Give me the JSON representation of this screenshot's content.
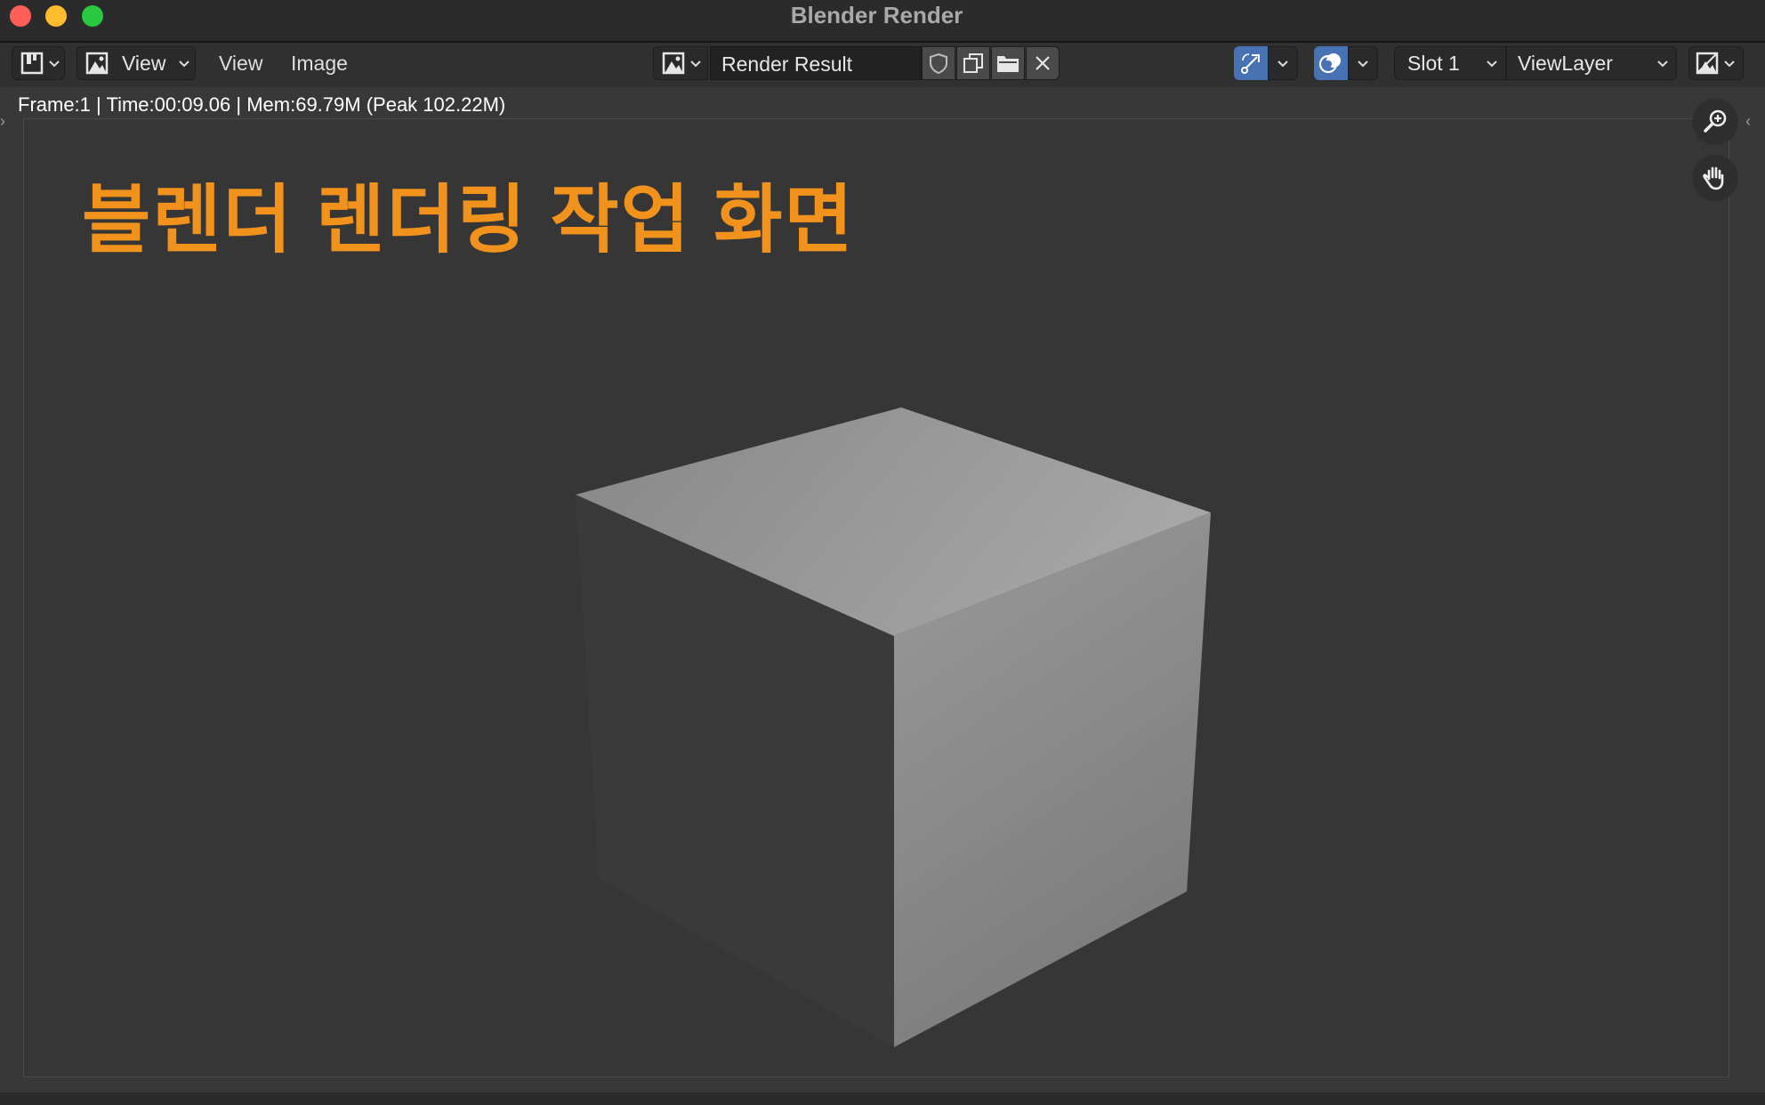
{
  "window": {
    "title": "Blender Render"
  },
  "header": {
    "view_dropdown_label": "View",
    "menus": [
      {
        "label": "View"
      },
      {
        "label": "Image"
      }
    ],
    "image_name": "Render Result",
    "slot_label": "Slot 1",
    "view_layer_label": "ViewLayer"
  },
  "status": {
    "text": "Frame:1 | Time:00:09.06 | Mem:69.79M (Peak 102.22M)"
  },
  "canvas": {
    "overlay_title": "블렌더 렌더링 작업 화면"
  },
  "icons": {
    "editor_type": "image-editor-icon",
    "view_mode": "image-view-icon",
    "browse_image": "browse-image-icon",
    "fake_user": "shield-icon",
    "new_image": "duplicate-icon",
    "open_image": "folder-icon",
    "unlink": "close-icon",
    "gizmo": "gizmo-icon",
    "overlay": "overlay-icon",
    "display_channels": "display-channels-icon",
    "zoom": "zoom-icon",
    "pan": "hand-icon"
  },
  "colors": {
    "accent_orange": "#f0921c",
    "active_blue": "#4772b3",
    "background": "#383838"
  }
}
